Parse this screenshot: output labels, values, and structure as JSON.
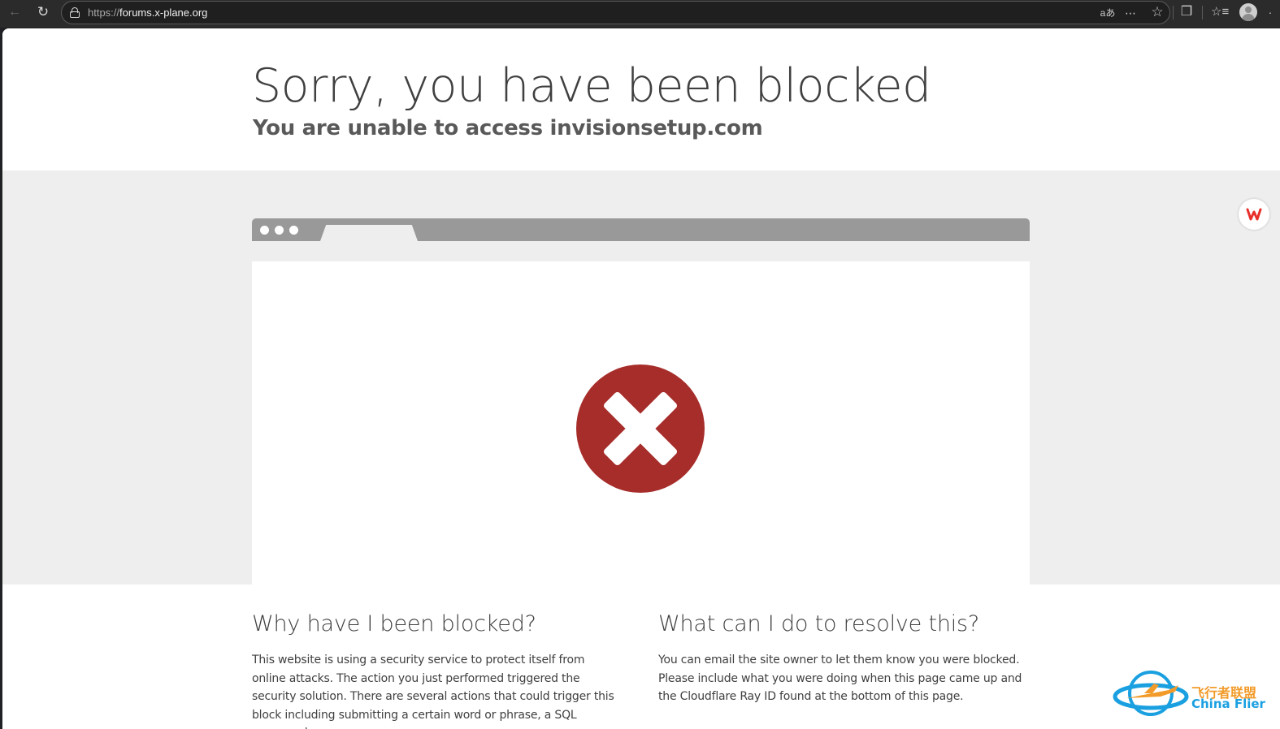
{
  "browser": {
    "url_scheme": "https://",
    "url_host": "forums.x-plane.org",
    "icons": [
      "back-icon",
      "reload-icon",
      "lock-icon",
      "translate-icon",
      "more-icon",
      "favorite-star-icon",
      "extensions-icon",
      "favorites-bar-icon",
      "profile-avatar-icon"
    ]
  },
  "page": {
    "headline": "Sorry, you have been blocked",
    "subheadline": "You are unable to access invisionsetup.com",
    "error_color": "#a62d2a",
    "why": {
      "heading": "Why have I been blocked?",
      "body": "This website is using a security service to protect itself from online attacks. The action you just performed triggered the security solution. There are several actions that could trigger this block including submitting a certain word or phrase, a SQL command or"
    },
    "resolve": {
      "heading": "What can I do to resolve this?",
      "body": "You can email the site owner to let them know you were blocked. Please include what you were doing when this page came up and the Cloudflare Ray ID found at the bottom of this page."
    }
  },
  "watermark": {
    "chinese": "飞行者联盟",
    "english": "China Flier"
  }
}
